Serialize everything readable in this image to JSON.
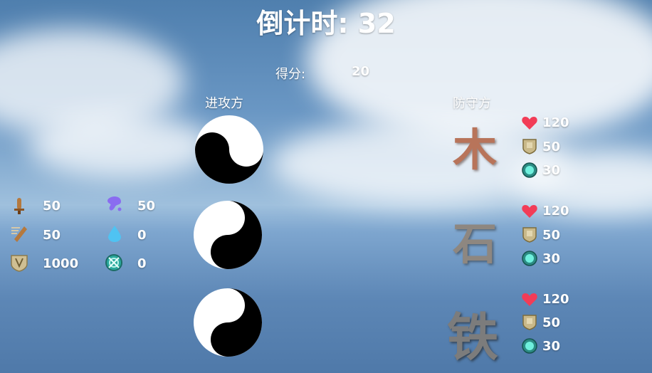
{
  "hud": {
    "countdown_label": "倒计时:",
    "countdown_value": "32",
    "score_label": "得分:",
    "score_value": "20"
  },
  "attacker": {
    "title": "进攻方",
    "units": [
      {
        "icon": "yin-yang-icon"
      },
      {
        "icon": "yin-yang-icon"
      },
      {
        "icon": "yin-yang-icon"
      }
    ]
  },
  "defender": {
    "title": "防守方",
    "units": [
      {
        "element": "木",
        "color": "#b8745a",
        "health": "120",
        "armor": "50",
        "shield": "30"
      },
      {
        "element": "石",
        "color": "#8e8780",
        "health": "120",
        "armor": "50",
        "shield": "30"
      },
      {
        "element": "铁",
        "color": "#7c7c7c",
        "health": "120",
        "armor": "50",
        "shield": "30"
      }
    ]
  },
  "resources": {
    "left": [
      {
        "icon": "sword-icon",
        "value": "50"
      },
      {
        "icon": "spear-icon",
        "value": "50"
      },
      {
        "icon": "shield-crest-icon",
        "value": "1000"
      }
    ],
    "right": [
      {
        "icon": "paint-splash-icon",
        "value": "50"
      },
      {
        "icon": "water-drop-icon",
        "value": "0"
      },
      {
        "icon": "crossed-orb-icon",
        "value": "0"
      }
    ]
  },
  "colors": {
    "health": "#f23c57",
    "armor": "#c9b98a",
    "shield": "#4fd2c4"
  }
}
